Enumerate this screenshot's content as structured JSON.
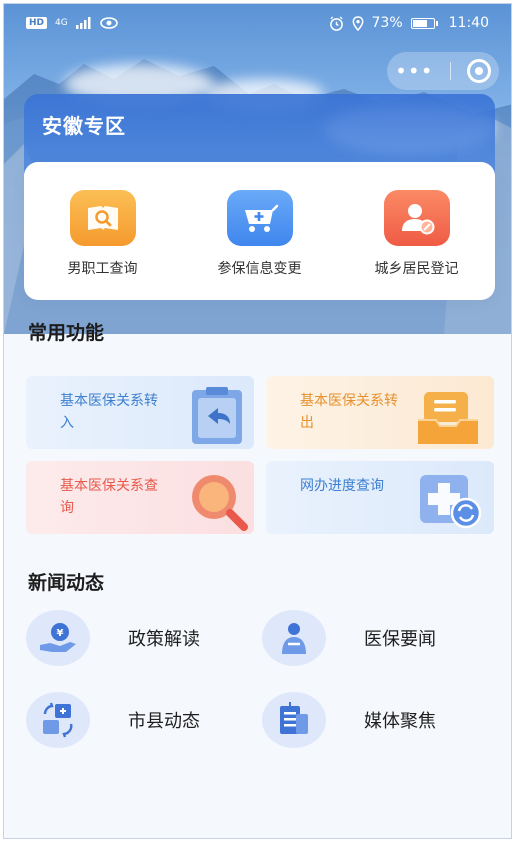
{
  "status_bar": {
    "network_badge": "HD",
    "network_type": "4G",
    "battery_percent_text": "73%",
    "battery_level": 0.73,
    "time": "11:40"
  },
  "capsule": {
    "more_icon": "more-dots-icon",
    "close_icon": "target-close-icon"
  },
  "zone": {
    "title": "安徽专区"
  },
  "quick_actions": [
    {
      "label": "男职工查询",
      "icon": "search-document-icon",
      "color": "#f7a13a"
    },
    {
      "label": "参保信息变更",
      "icon": "hospital-cart-icon",
      "color": "#4a90f0"
    },
    {
      "label": "城乡居民登记",
      "icon": "person-edit-icon",
      "color": "#f2664d"
    }
  ],
  "common": {
    "title": "常用功能",
    "tiles": [
      {
        "label": "基本医保关系转入",
        "icon": "clipboard-return-icon",
        "text_color": "#3d7fd1",
        "bg": "#e6f0fc"
      },
      {
        "label": "基本医保关系转出",
        "icon": "tray-out-icon",
        "text_color": "#e8902d",
        "bg": "#fdf1e2"
      },
      {
        "label": "基本医保关系查询",
        "icon": "magnifier-icon",
        "text_color": "#e8594c",
        "bg": "#fde8e8"
      },
      {
        "label": "网办进度查询",
        "icon": "medical-progress-icon",
        "text_color": "#3d7fd1",
        "bg": "#e6f0fc"
      }
    ]
  },
  "news": {
    "title": "新闻动态",
    "items": [
      {
        "label": "政策解读",
        "icon": "hand-coin-icon"
      },
      {
        "label": "医保要闻",
        "icon": "person-shield-icon"
      },
      {
        "label": "市县动态",
        "icon": "refresh-grid-icon"
      },
      {
        "label": "媒体聚焦",
        "icon": "document-building-icon"
      }
    ]
  }
}
